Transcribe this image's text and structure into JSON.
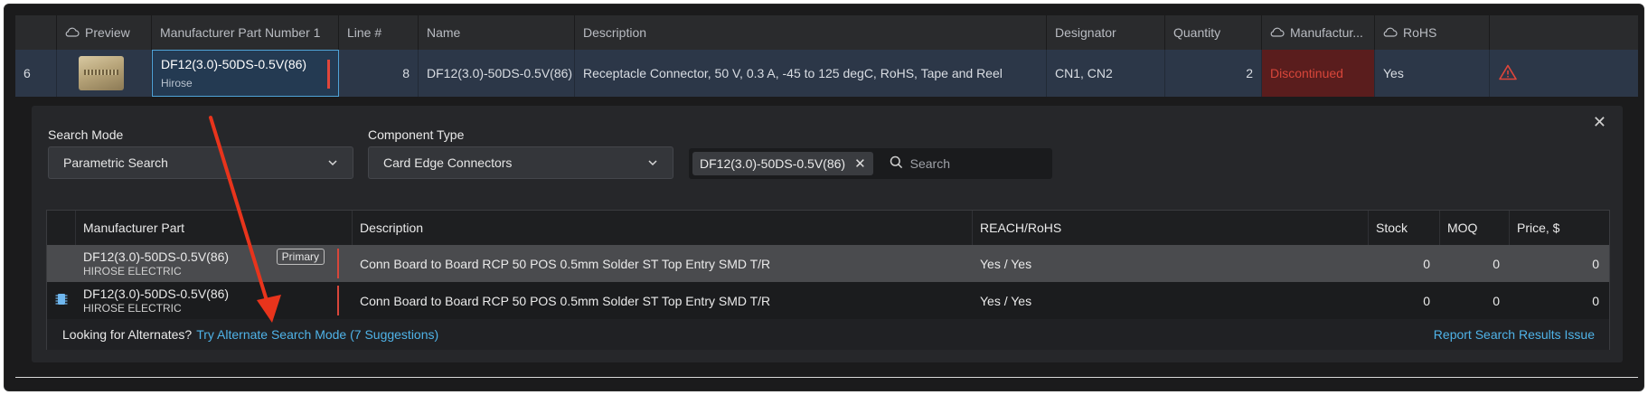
{
  "header": {
    "cols": [
      "",
      "Preview",
      "Manufacturer Part Number 1",
      "Line #",
      "Name",
      "Description",
      "Designator",
      "Quantity",
      "Manufactur...",
      "RoHS",
      ""
    ]
  },
  "row": {
    "index": "6",
    "mpn": "DF12(3.0)-50DS-0.5V(86)",
    "manufacturer": "Hirose",
    "line": "8",
    "name": "DF12(3.0)-50DS-0.5V(86)",
    "description": "Receptacle Connector, 50 V, 0.3 A, -45 to 125 degC, RoHS, Tape and Reel",
    "designator": "CN1, CN2",
    "quantity": "2",
    "lifecycle": "Discontinued",
    "rohs": "Yes"
  },
  "panel": {
    "search_mode_label": "Search Mode",
    "search_mode_value": "Parametric Search",
    "component_type_label": "Component Type",
    "component_type_value": "Card Edge Connectors",
    "chip": "DF12(3.0)-50DS-0.5V(86)",
    "search_placeholder": "Search"
  },
  "results": {
    "headers": [
      "Manufacturer Part",
      "Description",
      "REACH/RoHS",
      "Stock",
      "MOQ",
      "Price, $"
    ],
    "primary_tag": "Primary",
    "rows": [
      {
        "part": "DF12(3.0)-50DS-0.5V(86)",
        "mfr": "HIROSE ELECTRIC",
        "desc": "Conn Board to Board RCP 50 POS 0.5mm Solder ST Top Entry SMD T/R",
        "reach": "Yes / Yes",
        "stock": "0",
        "moq": "0",
        "price": "0"
      },
      {
        "part": "DF12(3.0)-50DS-0.5V(86)",
        "mfr": "HIROSE ELECTRIC",
        "desc": "Conn Board to Board RCP 50 POS 0.5mm Solder ST Top Entry SMD T/R",
        "reach": "Yes / Yes",
        "stock": "0",
        "moq": "0",
        "price": "0"
      }
    ],
    "footer_question": "Looking for Alternates?",
    "footer_link": "Try Alternate Search Mode (7 Suggestions)",
    "report_link": "Report Search Results Issue"
  },
  "colors": {
    "accent": "#4fb3e8",
    "danger": "#d8463a",
    "selected_row": "#2c3748",
    "arrow": "#e8341c"
  },
  "icons": [
    "cloud-icon",
    "chevron-down-icon",
    "search-icon",
    "close-icon",
    "warning-icon",
    "chip-icon"
  ]
}
